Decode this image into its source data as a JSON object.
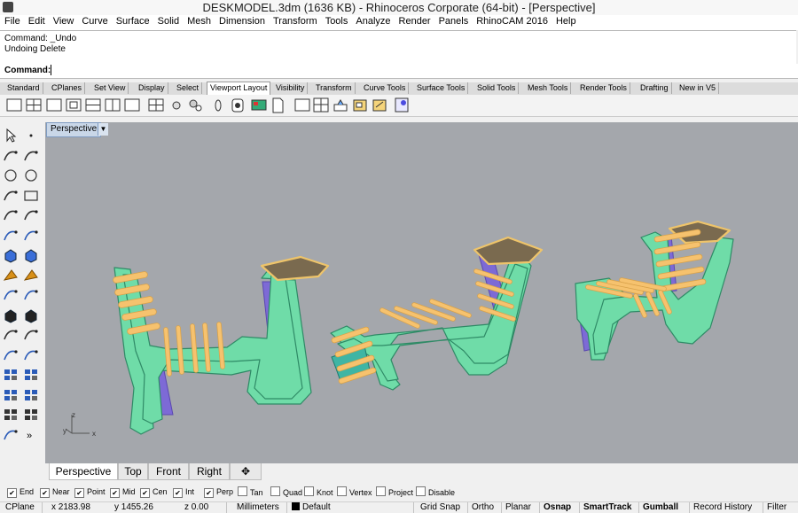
{
  "window": {
    "title": "DESKMODEL.3dm (1636 KB) - Rhinoceros Corporate (64-bit) - [Perspective]"
  },
  "menu": [
    "File",
    "Edit",
    "View",
    "Curve",
    "Surface",
    "Solid",
    "Mesh",
    "Dimension",
    "Transform",
    "Tools",
    "Analyze",
    "Render",
    "Panels",
    "RhinoCAM 2016",
    "Help"
  ],
  "command_history": [
    "Command: _Undo",
    "Undoing Delete"
  ],
  "command_prompt": {
    "label": "Command:",
    "value": ""
  },
  "toolbar_tabs": [
    "Standard",
    "CPlanes",
    "Set View",
    "Display",
    "Select",
    "Viewport Layout",
    "Visibility",
    "Transform",
    "Curve Tools",
    "Surface Tools",
    "Solid Tools",
    "Mesh Tools",
    "Render Tools",
    "Drafting",
    "New in V5"
  ],
  "active_toolbar_tab": "Viewport Layout",
  "toolbar_icons": [
    "single-viewport-icon",
    "four-viewports-icon",
    "maximize-viewport-icon",
    "toggle-maximize-icon",
    "split-horizontal-icon",
    "split-vertical-icon",
    "close-viewport-icon",
    "grid-layout-icon",
    "camera-icon",
    "set-camera-icon",
    "zoom-extents-icon",
    "named-view-icon",
    "viewport-properties-icon",
    "new-floating-viewport-icon",
    "new-layout-icon",
    "print-layout-icon",
    "layout-to-model-icon",
    "detail-icon",
    "enable-detail-icon",
    "print-icon"
  ],
  "left_tools": [
    [
      "select-arrow-icon",
      "point-icon"
    ],
    [
      "polyline-icon",
      "curve-icon"
    ],
    [
      "circle-icon",
      "ellipse-icon"
    ],
    [
      "arc-icon",
      "rectangle-icon"
    ],
    [
      "polygon-icon",
      "fillet-curve-icon"
    ],
    [
      "surface-from-points-icon",
      "extrude-curve-icon"
    ],
    [
      "box-icon",
      "sphere-icon"
    ],
    [
      "solid-tools-icon",
      "boolean-icon"
    ],
    [
      "edit-points-icon",
      "mesh-icon"
    ],
    [
      "sphere-solid-icon",
      "network-icon"
    ],
    [
      "rebuild-icon",
      "offset-icon"
    ],
    [
      "dimension-icon",
      "leader-icon"
    ],
    [
      "group-icon",
      "block-icon"
    ],
    [
      "box-select-icon",
      "layers-icon"
    ],
    [
      "array-icon",
      "match-icon"
    ],
    [
      "render-icon",
      "more-icon"
    ]
  ],
  "viewport": {
    "label": "Perspective",
    "axis_labels": {
      "x": "x",
      "y": "y",
      "z": "z"
    },
    "colors": {
      "background": "#a4a7ac",
      "frame": "#6fdca8",
      "slat": "#f6c26e",
      "panel": "#7d6ad6",
      "outline": "#eec46a",
      "top": "#7a6a4f"
    }
  },
  "viewport_tabs": [
    "Perspective",
    "Top",
    "Front",
    "Right"
  ],
  "active_viewport_tab": "Perspective",
  "osnaps": [
    {
      "label": "End",
      "checked": true
    },
    {
      "label": "Near",
      "checked": true
    },
    {
      "label": "Point",
      "checked": true
    },
    {
      "label": "Mid",
      "checked": true
    },
    {
      "label": "Cen",
      "checked": true
    },
    {
      "label": "Int",
      "checked": true
    },
    {
      "label": "Perp",
      "checked": true
    },
    {
      "label": "Tan",
      "checked": false
    },
    {
      "label": "Quad",
      "checked": false
    },
    {
      "label": "Knot",
      "checked": false
    },
    {
      "label": "Vertex",
      "checked": false
    },
    {
      "label": "Project",
      "checked": false
    },
    {
      "label": "Disable",
      "checked": false
    }
  ],
  "status": {
    "cplane": "CPlane",
    "x": "x 2183.98",
    "y": "y 1455.26",
    "z": "z 0.00",
    "units": "Millimeters",
    "layer": "Default",
    "toggles": [
      {
        "label": "Grid Snap",
        "on": false
      },
      {
        "label": "Ortho",
        "on": false
      },
      {
        "label": "Planar",
        "on": false
      },
      {
        "label": "Osnap",
        "on": true
      },
      {
        "label": "SmartTrack",
        "on": true
      },
      {
        "label": "Gumball",
        "on": true
      },
      {
        "label": "Record History",
        "on": false
      },
      {
        "label": "Filter",
        "on": false
      }
    ]
  }
}
